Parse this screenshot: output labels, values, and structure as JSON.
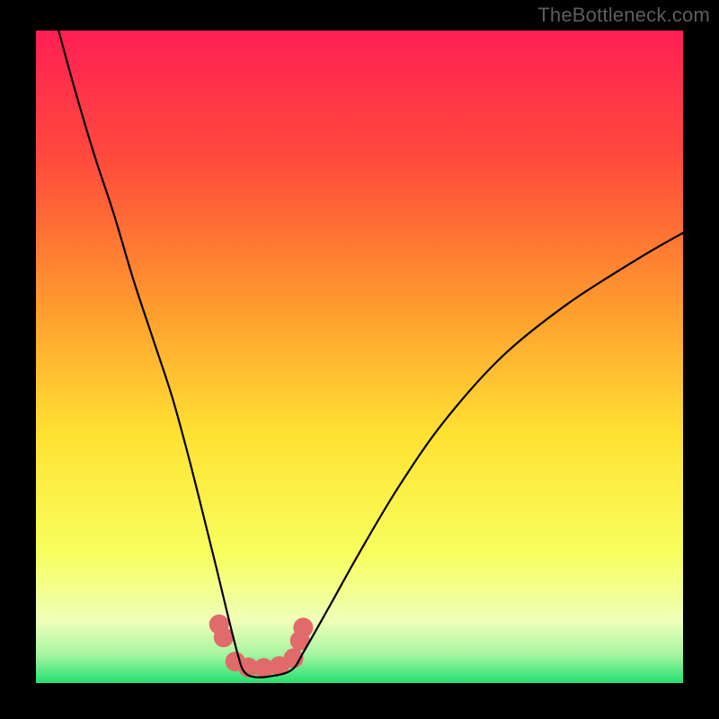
{
  "watermark_text": "TheBottleneck.com",
  "chart_data": {
    "type": "line",
    "title": "",
    "xlabel": "",
    "ylabel": "",
    "xlim": [
      0,
      1
    ],
    "ylim": [
      0,
      100
    ],
    "gradient_stops": [
      {
        "pos": 0,
        "color": "#ff1f55"
      },
      {
        "pos": 0.2,
        "color": "#ff4b3b"
      },
      {
        "pos": 0.42,
        "color": "#ff9a2e"
      },
      {
        "pos": 0.62,
        "color": "#ffe233"
      },
      {
        "pos": 0.8,
        "color": "#f8ff5d"
      },
      {
        "pos": 0.905,
        "color": "#efffb8"
      },
      {
        "pos": 0.955,
        "color": "#a9f5a2"
      },
      {
        "pos": 1.0,
        "color": "#23e070"
      }
    ],
    "series": [
      {
        "name": "bottleneck-curve",
        "x": [
          0.035,
          0.06,
          0.09,
          0.12,
          0.15,
          0.18,
          0.21,
          0.235,
          0.258,
          0.278,
          0.295,
          0.305,
          0.313,
          0.32,
          0.333,
          0.36,
          0.395,
          0.415,
          0.455,
          0.5,
          0.56,
          0.63,
          0.72,
          0.82,
          0.93,
          1.0
        ],
        "values": [
          100,
          91,
          81,
          72,
          62,
          53,
          44,
          35,
          26,
          18,
          11,
          7,
          4,
          2,
          1,
          1,
          2,
          5,
          12,
          20,
          30,
          40,
          50,
          58,
          65,
          69
        ]
      }
    ],
    "markers": {
      "name": "highlight-dots",
      "color": "#e16a6a",
      "radius": 11,
      "x": [
        0.283,
        0.29,
        0.308,
        0.328,
        0.352,
        0.376,
        0.398,
        0.408,
        0.413
      ],
      "values": [
        9.0,
        7.0,
        3.3,
        2.4,
        2.3,
        2.6,
        3.8,
        6.5,
        8.5
      ]
    }
  }
}
